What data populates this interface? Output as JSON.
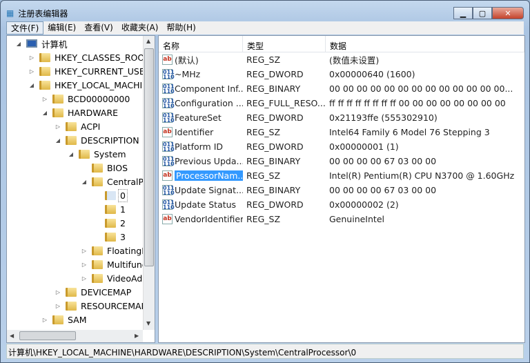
{
  "window": {
    "title": "注册表编辑器"
  },
  "menu": [
    "文件(F)",
    "编辑(E)",
    "查看(V)",
    "收藏夹(A)",
    "帮助(H)"
  ],
  "tree": [
    {
      "label": "计算机",
      "level": 0,
      "state": "expanded",
      "type": "computer"
    },
    {
      "label": "HKEY_CLASSES_ROOT",
      "level": 1,
      "state": "collapsed"
    },
    {
      "label": "HKEY_CURRENT_USER",
      "level": 1,
      "state": "collapsed"
    },
    {
      "label": "HKEY_LOCAL_MACHINE",
      "level": 1,
      "state": "expanded"
    },
    {
      "label": "BCD00000000",
      "level": 2,
      "state": "collapsed"
    },
    {
      "label": "HARDWARE",
      "level": 2,
      "state": "expanded"
    },
    {
      "label": "ACPI",
      "level": 3,
      "state": "collapsed"
    },
    {
      "label": "DESCRIPTION",
      "level": 3,
      "state": "expanded"
    },
    {
      "label": "System",
      "level": 4,
      "state": "expanded"
    },
    {
      "label": "BIOS",
      "level": 5,
      "state": "none"
    },
    {
      "label": "CentralProcessor",
      "level": 5,
      "state": "expanded"
    },
    {
      "label": "0",
      "level": 6,
      "state": "none",
      "selected": true
    },
    {
      "label": "1",
      "level": 6,
      "state": "none"
    },
    {
      "label": "2",
      "level": 6,
      "state": "none"
    },
    {
      "label": "3",
      "level": 6,
      "state": "none"
    },
    {
      "label": "FloatingPointProcessor",
      "level": 5,
      "state": "collapsed"
    },
    {
      "label": "MultifunctionAdapter",
      "level": 5,
      "state": "collapsed"
    },
    {
      "label": "VideoAdapterBusses",
      "level": 5,
      "state": "collapsed"
    },
    {
      "label": "DEVICEMAP",
      "level": 3,
      "state": "collapsed"
    },
    {
      "label": "RESOURCEMAP",
      "level": 3,
      "state": "collapsed"
    },
    {
      "label": "SAM",
      "level": 2,
      "state": "collapsed"
    }
  ],
  "columns": {
    "name": "名称",
    "type": "类型",
    "data": "数据"
  },
  "values": [
    {
      "icon": "sz",
      "name": "(默认)",
      "type": "REG_SZ",
      "data": "(数值未设置)"
    },
    {
      "icon": "bin",
      "name": "~MHz",
      "type": "REG_DWORD",
      "data": "0x00000640 (1600)"
    },
    {
      "icon": "bin",
      "name": "Component Inf...",
      "type": "REG_BINARY",
      "data": "00 00 00 00 00 00 00 00 00 00 00 00 00..."
    },
    {
      "icon": "bin",
      "name": "Configuration ...",
      "type": "REG_FULL_RESO...",
      "data": "ff ff ff ff ff ff ff ff 00 00 00 00 00 00 00 00"
    },
    {
      "icon": "bin",
      "name": "FeatureSet",
      "type": "REG_DWORD",
      "data": "0x21193ffe (555302910)"
    },
    {
      "icon": "sz",
      "name": "Identifier",
      "type": "REG_SZ",
      "data": "Intel64 Family 6 Model 76 Stepping 3"
    },
    {
      "icon": "bin",
      "name": "Platform ID",
      "type": "REG_DWORD",
      "data": "0x00000001 (1)"
    },
    {
      "icon": "bin",
      "name": "Previous Upda...",
      "type": "REG_BINARY",
      "data": "00 00 00 00 67 03 00 00"
    },
    {
      "icon": "sz",
      "name": "ProcessorNam...",
      "type": "REG_SZ",
      "data": "Intel(R) Pentium(R) CPU  N3700  @ 1.60GHz",
      "selected": true
    },
    {
      "icon": "bin",
      "name": "Update Signat...",
      "type": "REG_BINARY",
      "data": "00 00 00 00 67 03 00 00"
    },
    {
      "icon": "bin",
      "name": "Update Status",
      "type": "REG_DWORD",
      "data": "0x00000002 (2)"
    },
    {
      "icon": "sz",
      "name": "VendorIdentifier",
      "type": "REG_SZ",
      "data": "GenuineIntel"
    }
  ],
  "status": "计算机\\HKEY_LOCAL_MACHINE\\HARDWARE\\DESCRIPTION\\System\\CentralProcessor\\0"
}
